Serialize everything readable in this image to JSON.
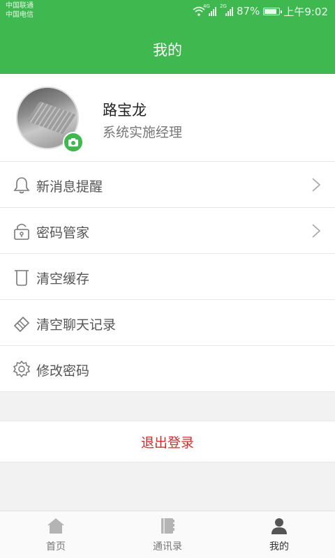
{
  "status_bar": {
    "carrier1": "中国联通",
    "carrier2": "中国电信",
    "net1": "4G",
    "net2": "2G",
    "battery": "87%",
    "time": "上午9:02"
  },
  "header": {
    "title": "我的"
  },
  "profile": {
    "name": "路宝龙",
    "role": "系统实施经理"
  },
  "menu": [
    {
      "label": "新消息提醒",
      "icon": "bell-icon",
      "chevron": true
    },
    {
      "label": "密码管家",
      "icon": "lock-icon",
      "chevron": true
    },
    {
      "label": "清空缓存",
      "icon": "trash-icon",
      "chevron": false
    },
    {
      "label": "清空聊天记录",
      "icon": "eraser-icon",
      "chevron": false
    },
    {
      "label": "修改密码",
      "icon": "gear-icon",
      "chevron": false
    }
  ],
  "logout_label": "退出登录",
  "tabs": [
    {
      "label": "首页",
      "icon": "home-icon",
      "active": false
    },
    {
      "label": "通讯录",
      "icon": "contacts-book-icon",
      "active": false
    },
    {
      "label": "我的",
      "icon": "person-icon",
      "active": true
    }
  ],
  "colors": {
    "primary": "#3eb84f",
    "logout": "#d62b2b"
  }
}
